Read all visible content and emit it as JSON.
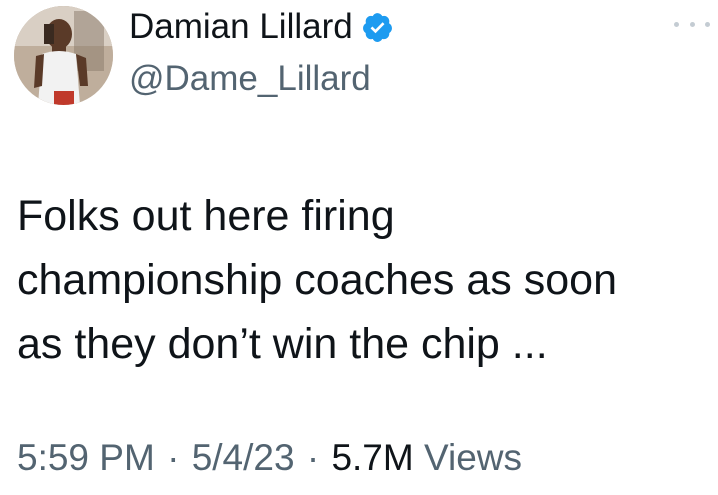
{
  "author": {
    "display_name": "Damian Lillard",
    "handle": "@Dame_Lillard",
    "verified": true,
    "verified_color": "#1d9bf0"
  },
  "tweet": {
    "lines": [
      "Folks out here firing",
      "championship coaches as soon",
      "as they don’t win the chip ..."
    ]
  },
  "meta": {
    "time": "5:59 PM",
    "separator": "·",
    "date": "5/4/23",
    "views_count": "5.7M",
    "views_label": "Views"
  },
  "icons": {
    "verified": "verified-badge-icon",
    "more": "more-options-icon"
  },
  "colors": {
    "text_primary": "#0f1419",
    "text_secondary": "#536471"
  }
}
